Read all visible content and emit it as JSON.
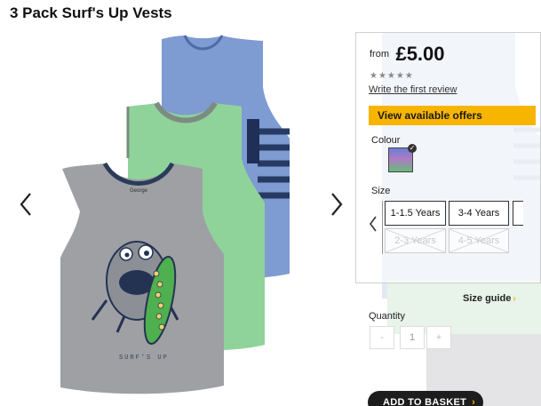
{
  "product": {
    "title": "3 Pack Surf's Up Vests"
  },
  "gallery": {
    "prev_icon": "chevron-left-icon",
    "next_icon": "chevron-right-icon",
    "shirt_print_text": "SURF'S UP",
    "label_text": "George"
  },
  "price": {
    "from_label": "from",
    "value": "£5.00"
  },
  "rating": {
    "stars": "★★★★★",
    "review_link": "Write the first review"
  },
  "offers": {
    "button_label": "View available offers",
    "accent_color": "#f7b500"
  },
  "colour": {
    "label": "Colour",
    "selected_icon": "check-icon"
  },
  "size": {
    "label": "Size",
    "options": [
      {
        "label": "1-1.5 Years",
        "available": true
      },
      {
        "label": "3-4 Years",
        "available": true
      },
      {
        "label": "2-3 Years",
        "available": false
      },
      {
        "label": "4-5 Years",
        "available": false
      }
    ],
    "guide_label": "Size guide",
    "guide_arrow": "›"
  },
  "quantity": {
    "label": "Quantity",
    "minus": "-",
    "value": "1",
    "plus": "+"
  },
  "basket": {
    "button_label": "ADD TO BASKET",
    "arrow": "›"
  }
}
